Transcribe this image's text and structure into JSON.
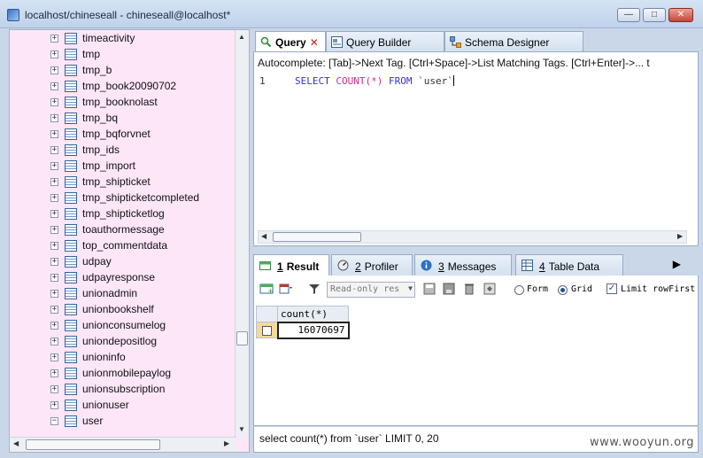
{
  "window": {
    "title": "localhost/chineseall - chineseall@localhost*",
    "buttons": {
      "minimize": "—",
      "maximize": "□",
      "close": "✕"
    }
  },
  "tree": {
    "items": [
      {
        "label": "timeactivity",
        "expander": "+"
      },
      {
        "label": "tmp",
        "expander": "+"
      },
      {
        "label": "tmp_b",
        "expander": "+"
      },
      {
        "label": "tmp_book20090702",
        "expander": "+"
      },
      {
        "label": "tmp_booknolast",
        "expander": "+"
      },
      {
        "label": "tmp_bq",
        "expander": "+"
      },
      {
        "label": "tmp_bqforvnet",
        "expander": "+"
      },
      {
        "label": "tmp_ids",
        "expander": "+"
      },
      {
        "label": "tmp_import",
        "expander": "+"
      },
      {
        "label": "tmp_shipticket",
        "expander": "+"
      },
      {
        "label": "tmp_shipticketcompleted",
        "expander": "+"
      },
      {
        "label": "tmp_shipticketlog",
        "expander": "+"
      },
      {
        "label": "toauthormessage",
        "expander": "+"
      },
      {
        "label": "top_commentdata",
        "expander": "+"
      },
      {
        "label": "udpay",
        "expander": "+"
      },
      {
        "label": "udpayresponse",
        "expander": "+"
      },
      {
        "label": "unionadmin",
        "expander": "+"
      },
      {
        "label": "unionbookshelf",
        "expander": "+"
      },
      {
        "label": "unionconsumelog",
        "expander": "+"
      },
      {
        "label": "uniondepositlog",
        "expander": "+"
      },
      {
        "label": "unioninfo",
        "expander": "+"
      },
      {
        "label": "unionmobilepaylog",
        "expander": "+"
      },
      {
        "label": "unionsubscription",
        "expander": "+"
      },
      {
        "label": "unionuser",
        "expander": "+"
      },
      {
        "label": "user",
        "expander": "−"
      }
    ]
  },
  "query_tabs": [
    {
      "label": "Query",
      "close": "✕"
    },
    {
      "label": "Query Builder"
    },
    {
      "label": "Schema Designer"
    }
  ],
  "editor": {
    "autocomplete_hint": "Autocomplete: [Tab]->Next Tag. [Ctrl+Space]->List Matching Tags. [Ctrl+Enter]->... t",
    "line_number": "1",
    "sql": {
      "kw1": "SELECT ",
      "fn": "COUNT",
      "paren": "(*) ",
      "kw2": "FROM ",
      "table": "`user`"
    }
  },
  "result_tabs": [
    {
      "num": "1",
      "label": "Result"
    },
    {
      "num": "2",
      "label": "Profiler"
    },
    {
      "num": "3",
      "label": "Messages"
    },
    {
      "num": "4",
      "label": "Table Data"
    }
  ],
  "result_toolbar": {
    "mode_select": "Read-only res",
    "form_label": "Form",
    "grid_label": "Grid",
    "limit_label": "Limit rowFirst",
    "view_mode": "Grid",
    "limit_checked": true
  },
  "grid": {
    "columns": [
      "count(*)"
    ],
    "rows": [
      [
        "16070697"
      ]
    ]
  },
  "status": {
    "text": "select count(*) from `user`  LIMIT 0, 20"
  },
  "watermark": "www.wooyun.org"
}
